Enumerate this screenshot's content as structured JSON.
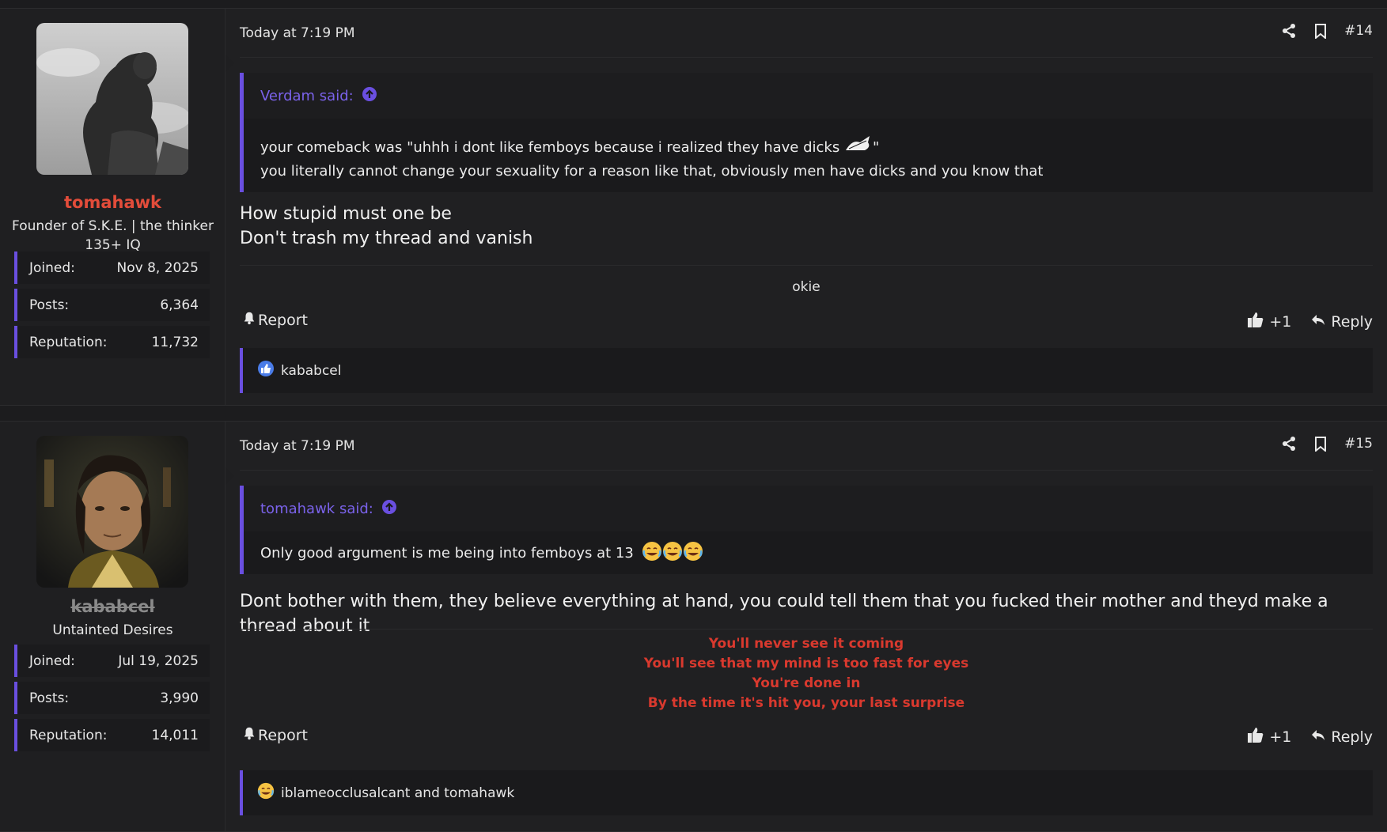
{
  "posts": [
    {
      "username": "tomahawk",
      "user_title_1": "Founder of S.K.E. | the thinker",
      "user_title_2": "135+ IQ",
      "stats": [
        {
          "label": "Joined:",
          "value": "Nov 8, 2025"
        },
        {
          "label": "Posts:",
          "value": "6,364"
        },
        {
          "label": "Reputation:",
          "value": "11,732"
        }
      ],
      "date": "Today at 7:19 PM",
      "post_number": "#14",
      "quote_author": "Verdam said:",
      "quote_line_1": "your comeback was \"uhhh i dont like femboys because i realized they have dicks",
      "quote_line_1_end": "\"",
      "quote_line_2": "you literally cannot change your sexuality for a reason like that, obviously men have dicks and you know that",
      "body_line_1": "How stupid must one be",
      "body_line_2": "Don't trash my thread and vanish",
      "signature": "okie",
      "report_label": "Report",
      "like_label": "+1",
      "reply_label": "Reply",
      "reactions_text": "kababcel"
    },
    {
      "username": "kababcel",
      "user_title_1": "Untainted Desires",
      "stats": [
        {
          "label": "Joined:",
          "value": "Jul 19, 2025"
        },
        {
          "label": "Posts:",
          "value": "3,990"
        },
        {
          "label": "Reputation:",
          "value": "14,011"
        }
      ],
      "date": "Today at 7:19 PM",
      "post_number": "#15",
      "quote_author": "tomahawk said:",
      "quote_line_1": "Only good argument is me being into femboys at 13",
      "body_line_1": "Dont bother with them, they believe everything at hand, you could tell them that you fucked their mother and theyd make a thread about it",
      "signature_lines": [
        "You'll never see it coming",
        "You'll see that my mind is too fast for eyes",
        "You're done in",
        "By the time it's hit you, your last surprise"
      ],
      "report_label": "Report",
      "like_label": "+1",
      "reply_label": "Reply",
      "reactions_text": "iblameocclusalcant and tomahawk"
    }
  ],
  "colors": {
    "accent": "#6a4fe0",
    "username_red": "#e24c3a",
    "signature_red": "#d9392e"
  }
}
